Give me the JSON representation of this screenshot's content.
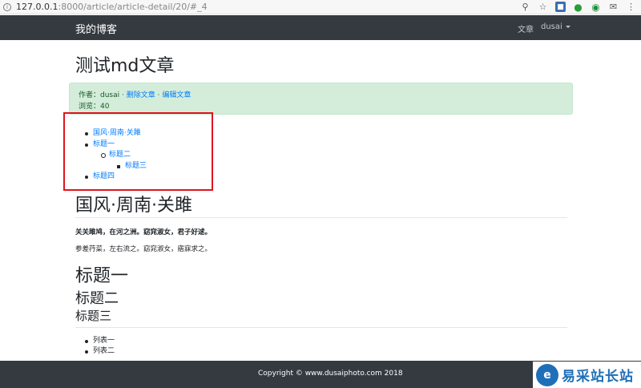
{
  "browser": {
    "url_host": "127.0.0.1",
    "url_rest": ":8000/article/article-detail/20/#_4"
  },
  "navbar": {
    "brand": "我的博客",
    "links": [
      "文章",
      "dusai"
    ]
  },
  "article": {
    "title": "测试md文章",
    "meta": {
      "author_label": "作者：dusai · ",
      "delete_link": "删除文章",
      "separator": " · ",
      "edit_link": "编辑文章",
      "views_label": "浏览：40"
    },
    "toc": {
      "item1": "国风·周南·关雎",
      "item2": "标题一",
      "item2_1": "标题二",
      "item2_1_1": "标题三",
      "item3": "标题四"
    },
    "heading1": "国风·周南·关雎",
    "bold_para": "关关雎鸠，在河之洲。窈窕淑女，君子好逑。",
    "normal_para": "参差荇菜，左右流之。窈窕淑女，寤寐求之。",
    "h1": "标题一",
    "h2": "标题二",
    "h3": "标题三",
    "list": [
      "列表一",
      "列表二"
    ]
  },
  "footer": {
    "copyright": "Copyright © www.dusaiphoto.com 2018"
  },
  "watermark": {
    "text": "易采站长站"
  }
}
